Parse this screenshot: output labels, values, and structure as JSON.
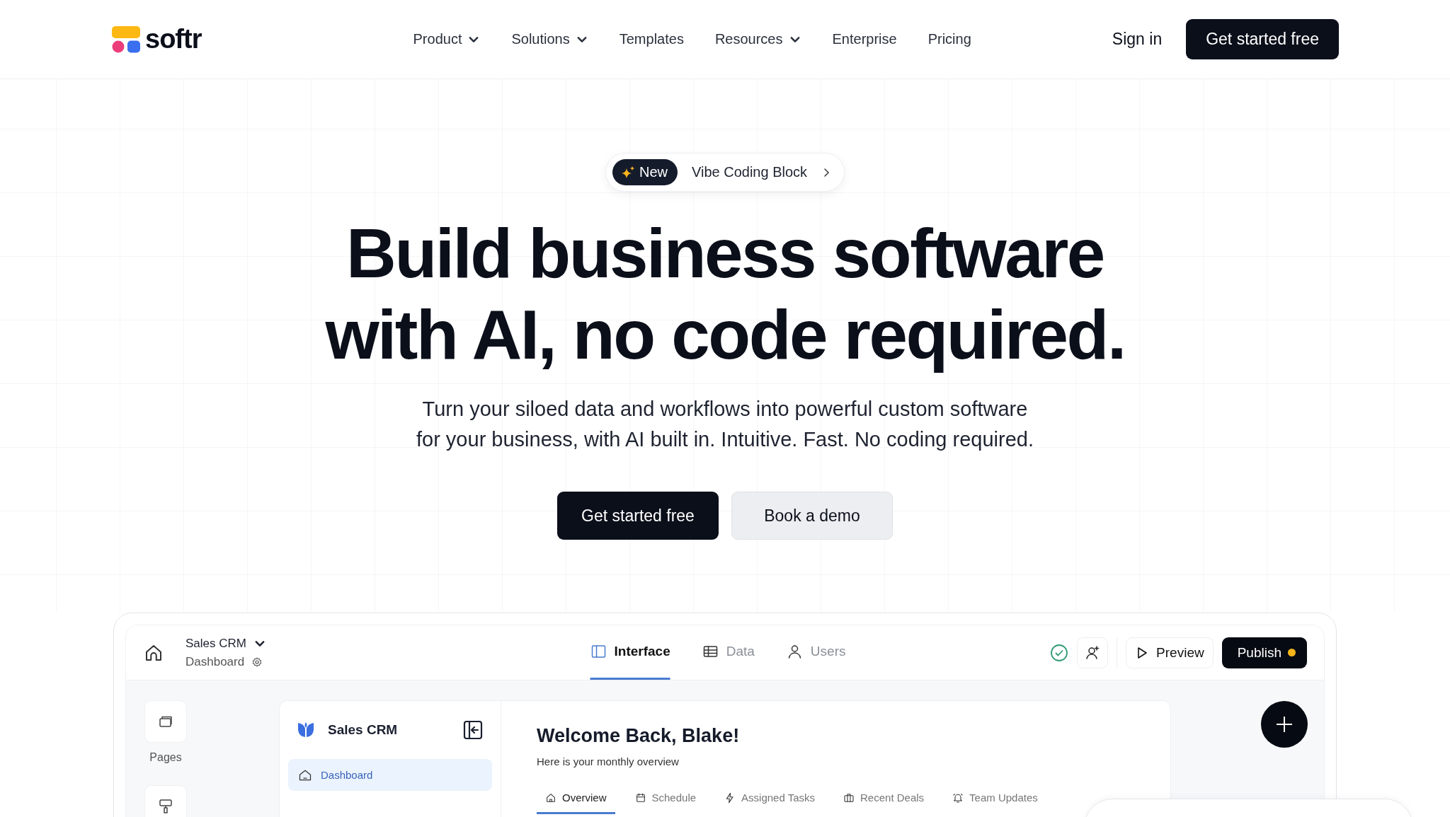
{
  "header": {
    "logo": "softr",
    "nav": [
      {
        "label": "Product",
        "dropdown": true
      },
      {
        "label": "Solutions",
        "dropdown": true
      },
      {
        "label": "Templates",
        "dropdown": false
      },
      {
        "label": "Resources",
        "dropdown": true
      },
      {
        "label": "Enterprise",
        "dropdown": false
      },
      {
        "label": "Pricing",
        "dropdown": false
      }
    ],
    "sign_in": "Sign in",
    "cta": "Get started free"
  },
  "hero": {
    "badge": {
      "tag": "New",
      "text": "Vibe Coding Block"
    },
    "headline": [
      "Build business software",
      "with AI, no code required."
    ],
    "subtitle": [
      "Turn your siloed data and workflows into powerful custom software",
      "for your business, with AI built in. Intuitive. Fast. No coding required."
    ],
    "buttons": [
      {
        "label": "Get started free",
        "kind": "primary"
      },
      {
        "label": "Book a demo",
        "kind": "secondary"
      }
    ]
  },
  "app": {
    "project": "Sales CRM",
    "page": "Dashboard",
    "tabs": [
      {
        "label": "Interface",
        "selected": true
      },
      {
        "label": "Data",
        "selected": false
      },
      {
        "label": "Users",
        "selected": false
      }
    ],
    "preview": "Preview",
    "publish": "Publish",
    "rail": [
      {
        "label": "Pages"
      }
    ],
    "sidebar": {
      "title": "Sales CRM",
      "items": [
        {
          "label": "Dashboard",
          "selected": true
        }
      ]
    },
    "main": {
      "title": "Welcome Back, Blake!",
      "subtitle": "Here is your monthly overview",
      "tabs": [
        {
          "label": "Overview",
          "selected": true
        },
        {
          "label": "Schedule",
          "selected": false
        },
        {
          "label": "Assigned Tasks",
          "selected": false
        },
        {
          "label": "Recent Deals",
          "selected": false
        },
        {
          "label": "Team Updates",
          "selected": false
        }
      ]
    }
  }
}
